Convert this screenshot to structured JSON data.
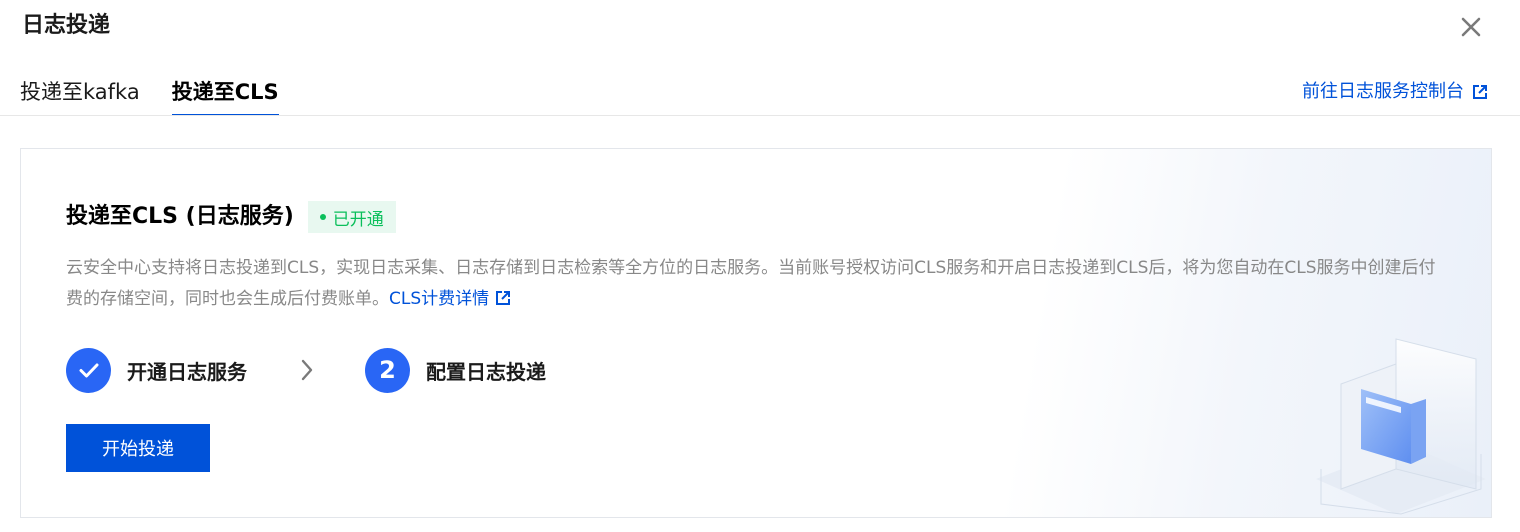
{
  "dialog": {
    "title": "日志投递",
    "close_icon": "close-icon"
  },
  "tabs": [
    {
      "label": "投递至kafka",
      "active": false
    },
    {
      "label": "投递至CLS",
      "active": true
    }
  ],
  "console_link": {
    "label": "前往日志服务控制台",
    "icon": "external-link-icon"
  },
  "card": {
    "title": "投递至CLS (日志服务)",
    "status": "已开通",
    "status_color": "#0abf5b",
    "description": "云安全中心支持将日志投递到CLS，实现日志采集、日志存储到日志检索等全方位的日志服务。当前账号授权访问CLS服务和开启日志投递到CLS后，将为您自动在CLS服务中创建后付费的存储空间，同时也会生成后付费账单。",
    "pricing_link": "CLS计费详情",
    "steps": [
      {
        "marker": "check-icon",
        "label": "开通日志服务",
        "done": true
      },
      {
        "marker": "2",
        "label": "配置日志投递",
        "done": false
      }
    ],
    "start_button": "开始投递"
  },
  "colors": {
    "primary": "#0052d9",
    "step": "#2966f5",
    "muted_text": "#888888"
  }
}
